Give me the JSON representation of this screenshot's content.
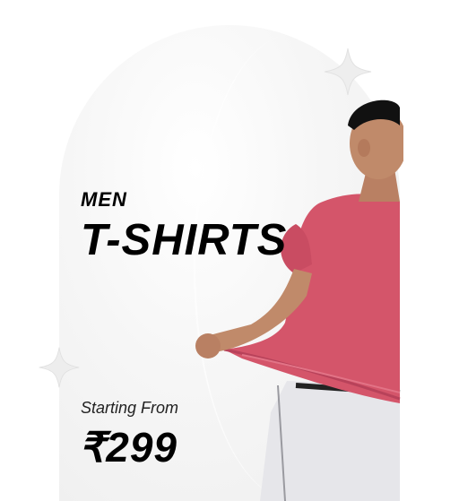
{
  "banner": {
    "category": "MEN",
    "title": "T-SHIRTS",
    "starting_label": "Starting From",
    "price": "₹299"
  },
  "colors": {
    "shirt": "#d4556a",
    "shorts": "#e6e6ea",
    "skin": "#c08a6a",
    "hair": "#111111",
    "card_bg": "#f4f4f4"
  },
  "icons": [
    "sparkle-icon"
  ]
}
